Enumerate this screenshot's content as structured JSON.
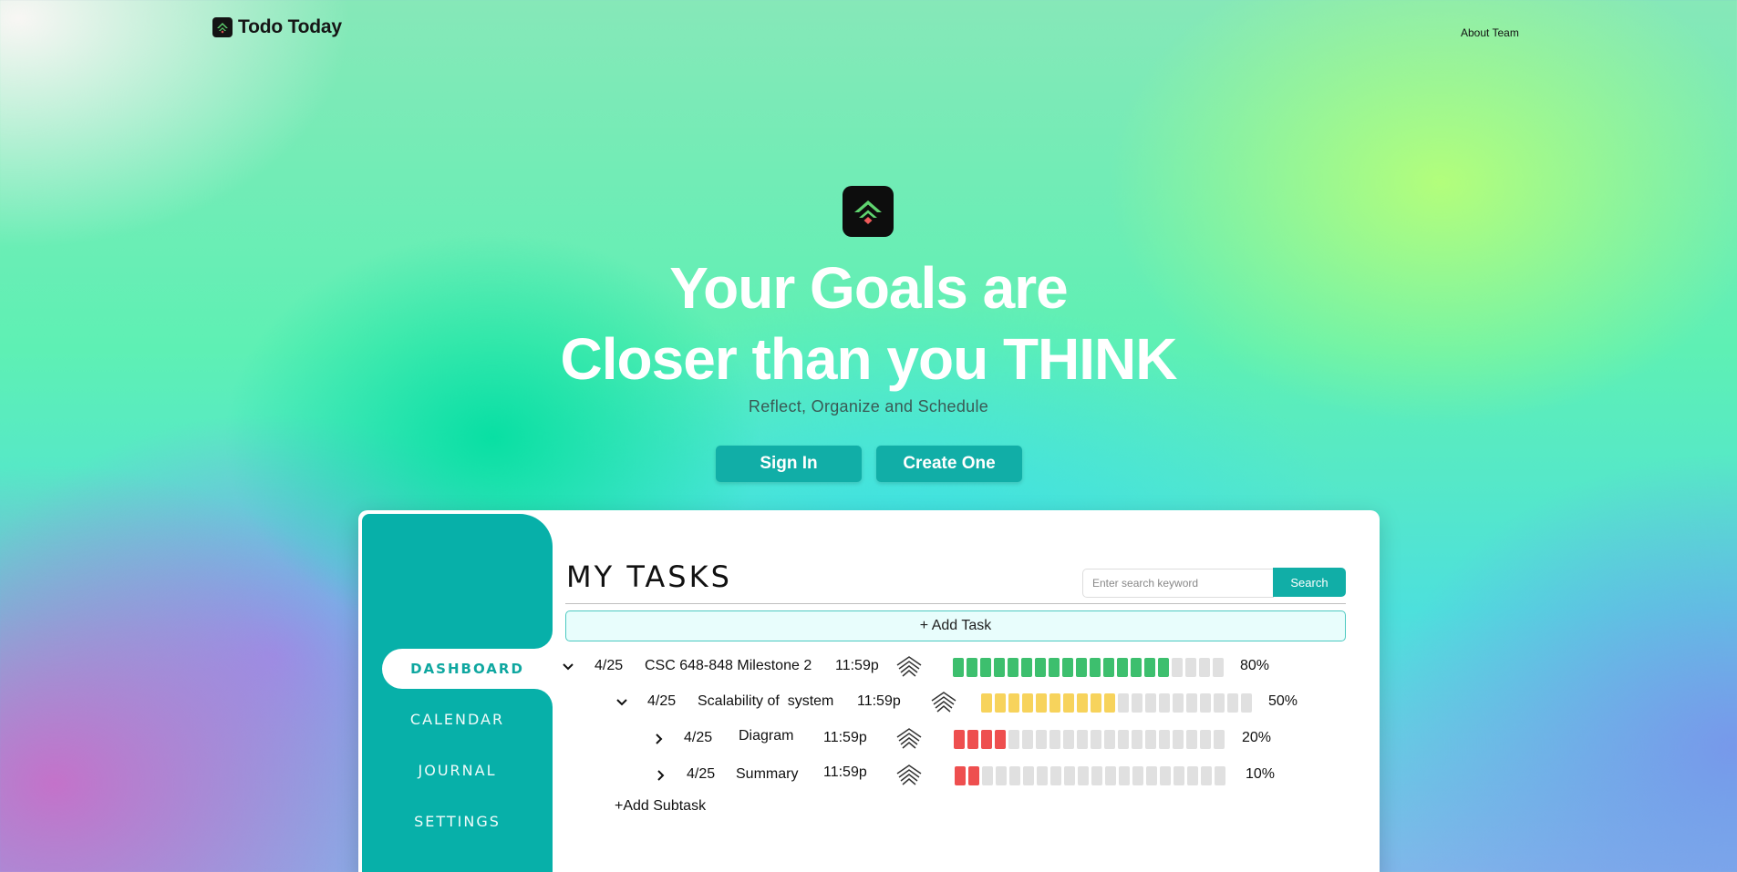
{
  "nav": {
    "brand_name": "Todo Today",
    "about_link": "About Team"
  },
  "hero": {
    "headline_line1": "Your Goals are",
    "headline_line2": "Closer than you THINK",
    "subtitle": "Reflect, Organize and Schedule",
    "signin_label": "Sign In",
    "create_label": "Create One"
  },
  "sidebar": {
    "items": [
      {
        "label": "DASHBOARD",
        "active": true
      },
      {
        "label": "CALENDAR",
        "active": false
      },
      {
        "label": "JOURNAL",
        "active": false
      },
      {
        "label": "SETTINGS",
        "active": false
      }
    ]
  },
  "main": {
    "title": "MY TASKS",
    "search_placeholder": "Enter search keyword",
    "search_label": "Search",
    "add_task_label": "+ Add Task",
    "add_subtask_label": "+Add Subtask",
    "tasks": [
      {
        "date": "4/25",
        "name": "CSC 648-848 Milestone 2",
        "time": "11:59p",
        "progress": 80,
        "progress_label": "80%",
        "expanded": true,
        "level": 0
      },
      {
        "date": "4/25",
        "name": "Scalability of  system",
        "time": "11:59p",
        "progress": 50,
        "progress_label": "50%",
        "expanded": true,
        "level": 1
      },
      {
        "date": "4/25",
        "name": "Diagram",
        "time": "11:59p",
        "progress": 20,
        "progress_label": "20%",
        "expanded": false,
        "level": 2
      },
      {
        "date": "4/25",
        "name": "Summary",
        "time": "11:59p",
        "progress": 10,
        "progress_label": "10%",
        "expanded": false,
        "level": 2
      }
    ]
  },
  "icons": {
    "brand": "chevron-up-logo-icon",
    "priority": "stacked-chevron-up-icon",
    "expanded": "chevron-down-icon",
    "collapsed": "chevron-right-icon"
  },
  "colors": {
    "accent": "#11aea7",
    "progress_high": "#3dbf6e",
    "progress_mid": "#f7d35c",
    "progress_low": "#ee4f4f",
    "progress_empty": "#e0e0e0"
  }
}
